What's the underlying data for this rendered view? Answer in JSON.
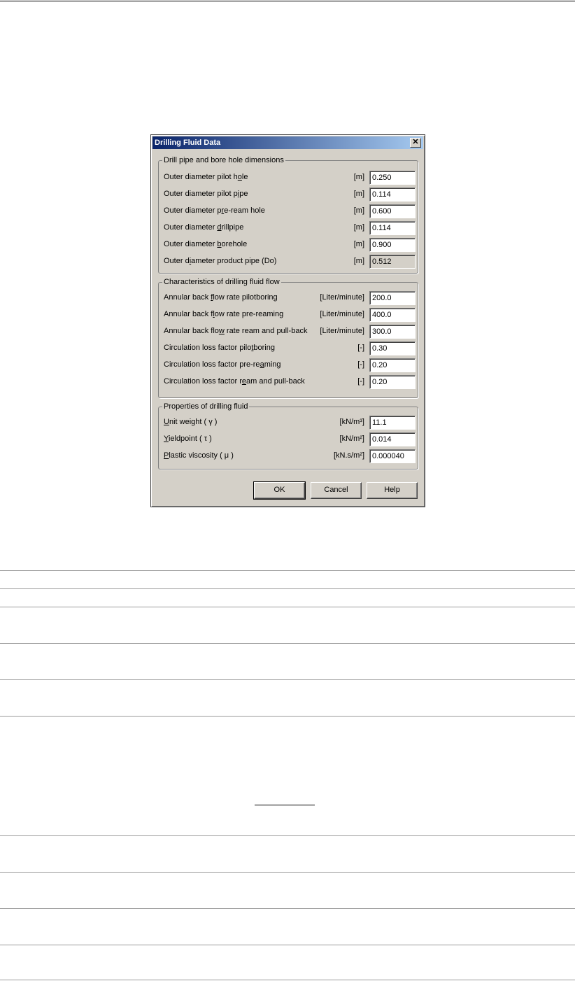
{
  "dialog": {
    "title": "Drilling Fluid Data",
    "close_glyph": "✕",
    "groups": [
      {
        "legend": "Drill pipe and bore hole dimensions",
        "rows": [
          {
            "pre": "Outer diameter pilot h",
            "key": "o",
            "post": "le",
            "unit": "[m]",
            "value": "0.250"
          },
          {
            "pre": "Outer diameter pilot p",
            "key": "i",
            "post": "pe",
            "unit": "[m]",
            "value": "0.114"
          },
          {
            "pre": "Outer diameter p",
            "key": "r",
            "post": "e-ream hole",
            "unit": "[m]",
            "value": "0.600"
          },
          {
            "pre": "Outer diameter ",
            "key": "d",
            "post": "rillpipe",
            "unit": "[m]",
            "value": "0.114"
          },
          {
            "pre": "Outer diameter ",
            "key": "b",
            "post": "orehole",
            "unit": "[m]",
            "value": "0.900"
          },
          {
            "pre": "Outer d",
            "key": "i",
            "post": "ameter product pipe (Do)",
            "unit": "[m]",
            "value": "0.512",
            "readonly": true
          }
        ]
      },
      {
        "legend": "Characteristics of drilling fluid flow",
        "rows": [
          {
            "pre": "Annular back ",
            "key": "f",
            "post": "low rate pilotboring",
            "unit": "[Liter/minute]",
            "value": "200.0"
          },
          {
            "pre": "Annular back f",
            "key": "l",
            "post": "ow rate pre-reaming",
            "unit": "[Liter/minute]",
            "value": "400.0"
          },
          {
            "pre": "Annular back flo",
            "key": "w",
            "post": " rate ream and pull-back",
            "unit": "[Liter/minute]",
            "value": "300.0"
          },
          {
            "pre": "Circulation loss factor pilo",
            "key": "t",
            "post": "boring",
            "unit": "[-]",
            "value": "0.30"
          },
          {
            "pre": "Circulation loss factor pre-re",
            "key": "a",
            "post": "ming",
            "unit": "[-]",
            "value": "0.20"
          },
          {
            "pre": "Circulation loss factor r",
            "key": "e",
            "post": "am and pull-back",
            "unit": "[-]",
            "value": "0.20"
          }
        ]
      },
      {
        "legend": "Properties of drilling fluid",
        "rows": [
          {
            "pre": "",
            "key": "U",
            "post": "nit weight  ( γ )",
            "unit": "[kN/m³]",
            "value": "11.1"
          },
          {
            "pre": "",
            "key": "Y",
            "post": "ieldpoint  ( τ )",
            "unit": "[kN/m²]",
            "value": "0.014"
          },
          {
            "pre": "",
            "key": "P",
            "post": "lastic viscosity  ( μ )",
            "unit": "[kN.s/m²]",
            "value": "0.000040"
          }
        ]
      }
    ],
    "buttons": {
      "ok": "OK",
      "cancel": "Cancel",
      "help": "Help"
    }
  }
}
